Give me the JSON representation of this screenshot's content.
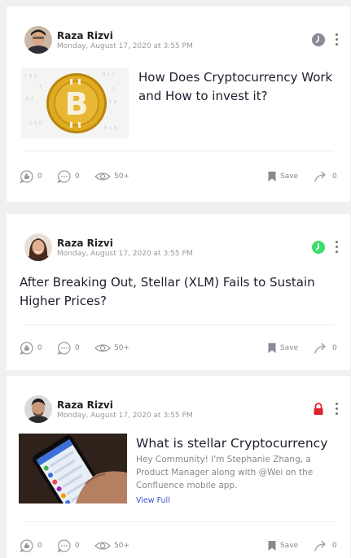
{
  "posts": [
    {
      "author": "Raza Rizvi",
      "date": "Monday, August 17, 2020 at 3:55 PM",
      "status_icon": "clock-icon",
      "status_color": "#8a8a96",
      "title": "How Does Cryptocurrency Work and How to invest it?",
      "thumbnail": "bitcoin-coin-image",
      "likes": "0",
      "comments": "0",
      "views": "50+",
      "save_label": "Save",
      "shares": "0"
    },
    {
      "author": "Raza Rizvi",
      "date": "Monday, August 17, 2020 at 3:55 PM",
      "status_icon": "clock-icon",
      "status_color": "#3ddc6b",
      "title": "After Breaking Out, Stellar (XLM) Fails to Sustain Higher Prices?",
      "likes": "0",
      "comments": "0",
      "views": "50+",
      "save_label": "Save",
      "shares": "0"
    },
    {
      "author": "Raza Rizvi",
      "date": "Monday, August 17, 2020 at 3:55 PM",
      "status_icon": "lock-icon",
      "status_color": "#e0202a",
      "title": "What is stellar Cryptocurrency",
      "excerpt": "Hey Community! I'm Stephanie Zhang, a Product Manager along with @Wei on the Confluence mobile app.",
      "view_full": "View Full",
      "thumbnail": "phone-in-hand-image",
      "likes": "0",
      "comments": "0",
      "views": "50+",
      "save_label": "Save",
      "shares": "0"
    }
  ]
}
